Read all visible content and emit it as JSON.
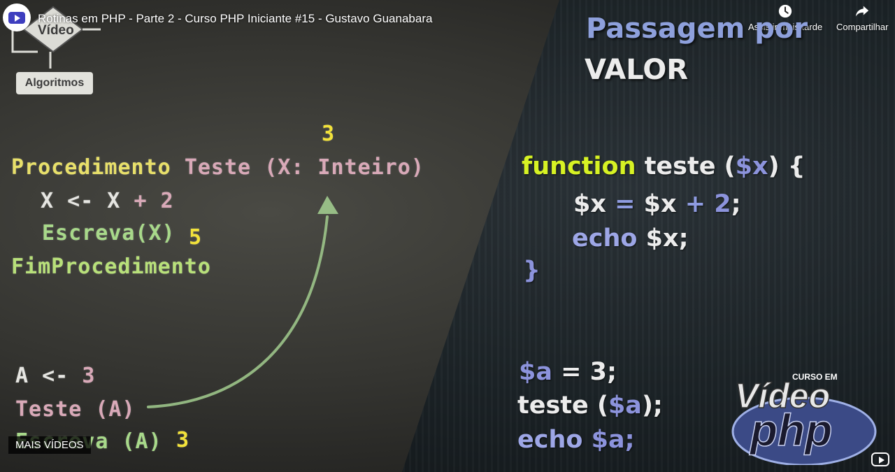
{
  "header": {
    "title": "Rotinas em PHP - Parte 2 - Curso PHP Iniciante #15 - Gustavo Guanabara",
    "watch_later": "Assistir mais tarde",
    "share": "Compartilhar"
  },
  "badge": {
    "top": "Vídeo",
    "bottom": "Algoritmos"
  },
  "left_code": {
    "num_top": "3",
    "line1_kw": "Procedimento",
    "line1_name": "Teste",
    "line1_params": "(X: Inteiro)",
    "line2": "X <- X",
    "line2_plus": "+",
    "line2_num": "2",
    "line3": "Escreva(X)",
    "line3_result": "5",
    "line4": "FimProcedimento",
    "call1_var": "A <-",
    "call1_num": "3",
    "call2": "Teste (A)",
    "call3": "Escreva (A)",
    "call3_result": "3"
  },
  "right_code": {
    "heading1": "Passagem por",
    "heading2": "VALOR",
    "fn_kw": "function",
    "fn_name": "teste (",
    "fn_param": "$x",
    "fn_close": ") {",
    "l2_var": "$x",
    "l2_eq": "=",
    "l2_var2": "$x",
    "l2_plus": "+",
    "l2_num": "2",
    "l2_semi": ";",
    "l3_echo": "echo",
    "l3_var": "$x;",
    "l4": "}",
    "c1_var": "$a",
    "c1_rest": "= 3;",
    "c2_fn": "teste (",
    "c2_var": "$a",
    "c2_close": ");",
    "c3_echo": "echo",
    "c3_var": "$a;"
  },
  "logo": {
    "small": "CURSO EM",
    "big1": "Vídeo",
    "big2": "php"
  },
  "footer": {
    "more_videos": "MAIS VÍDEOS"
  }
}
